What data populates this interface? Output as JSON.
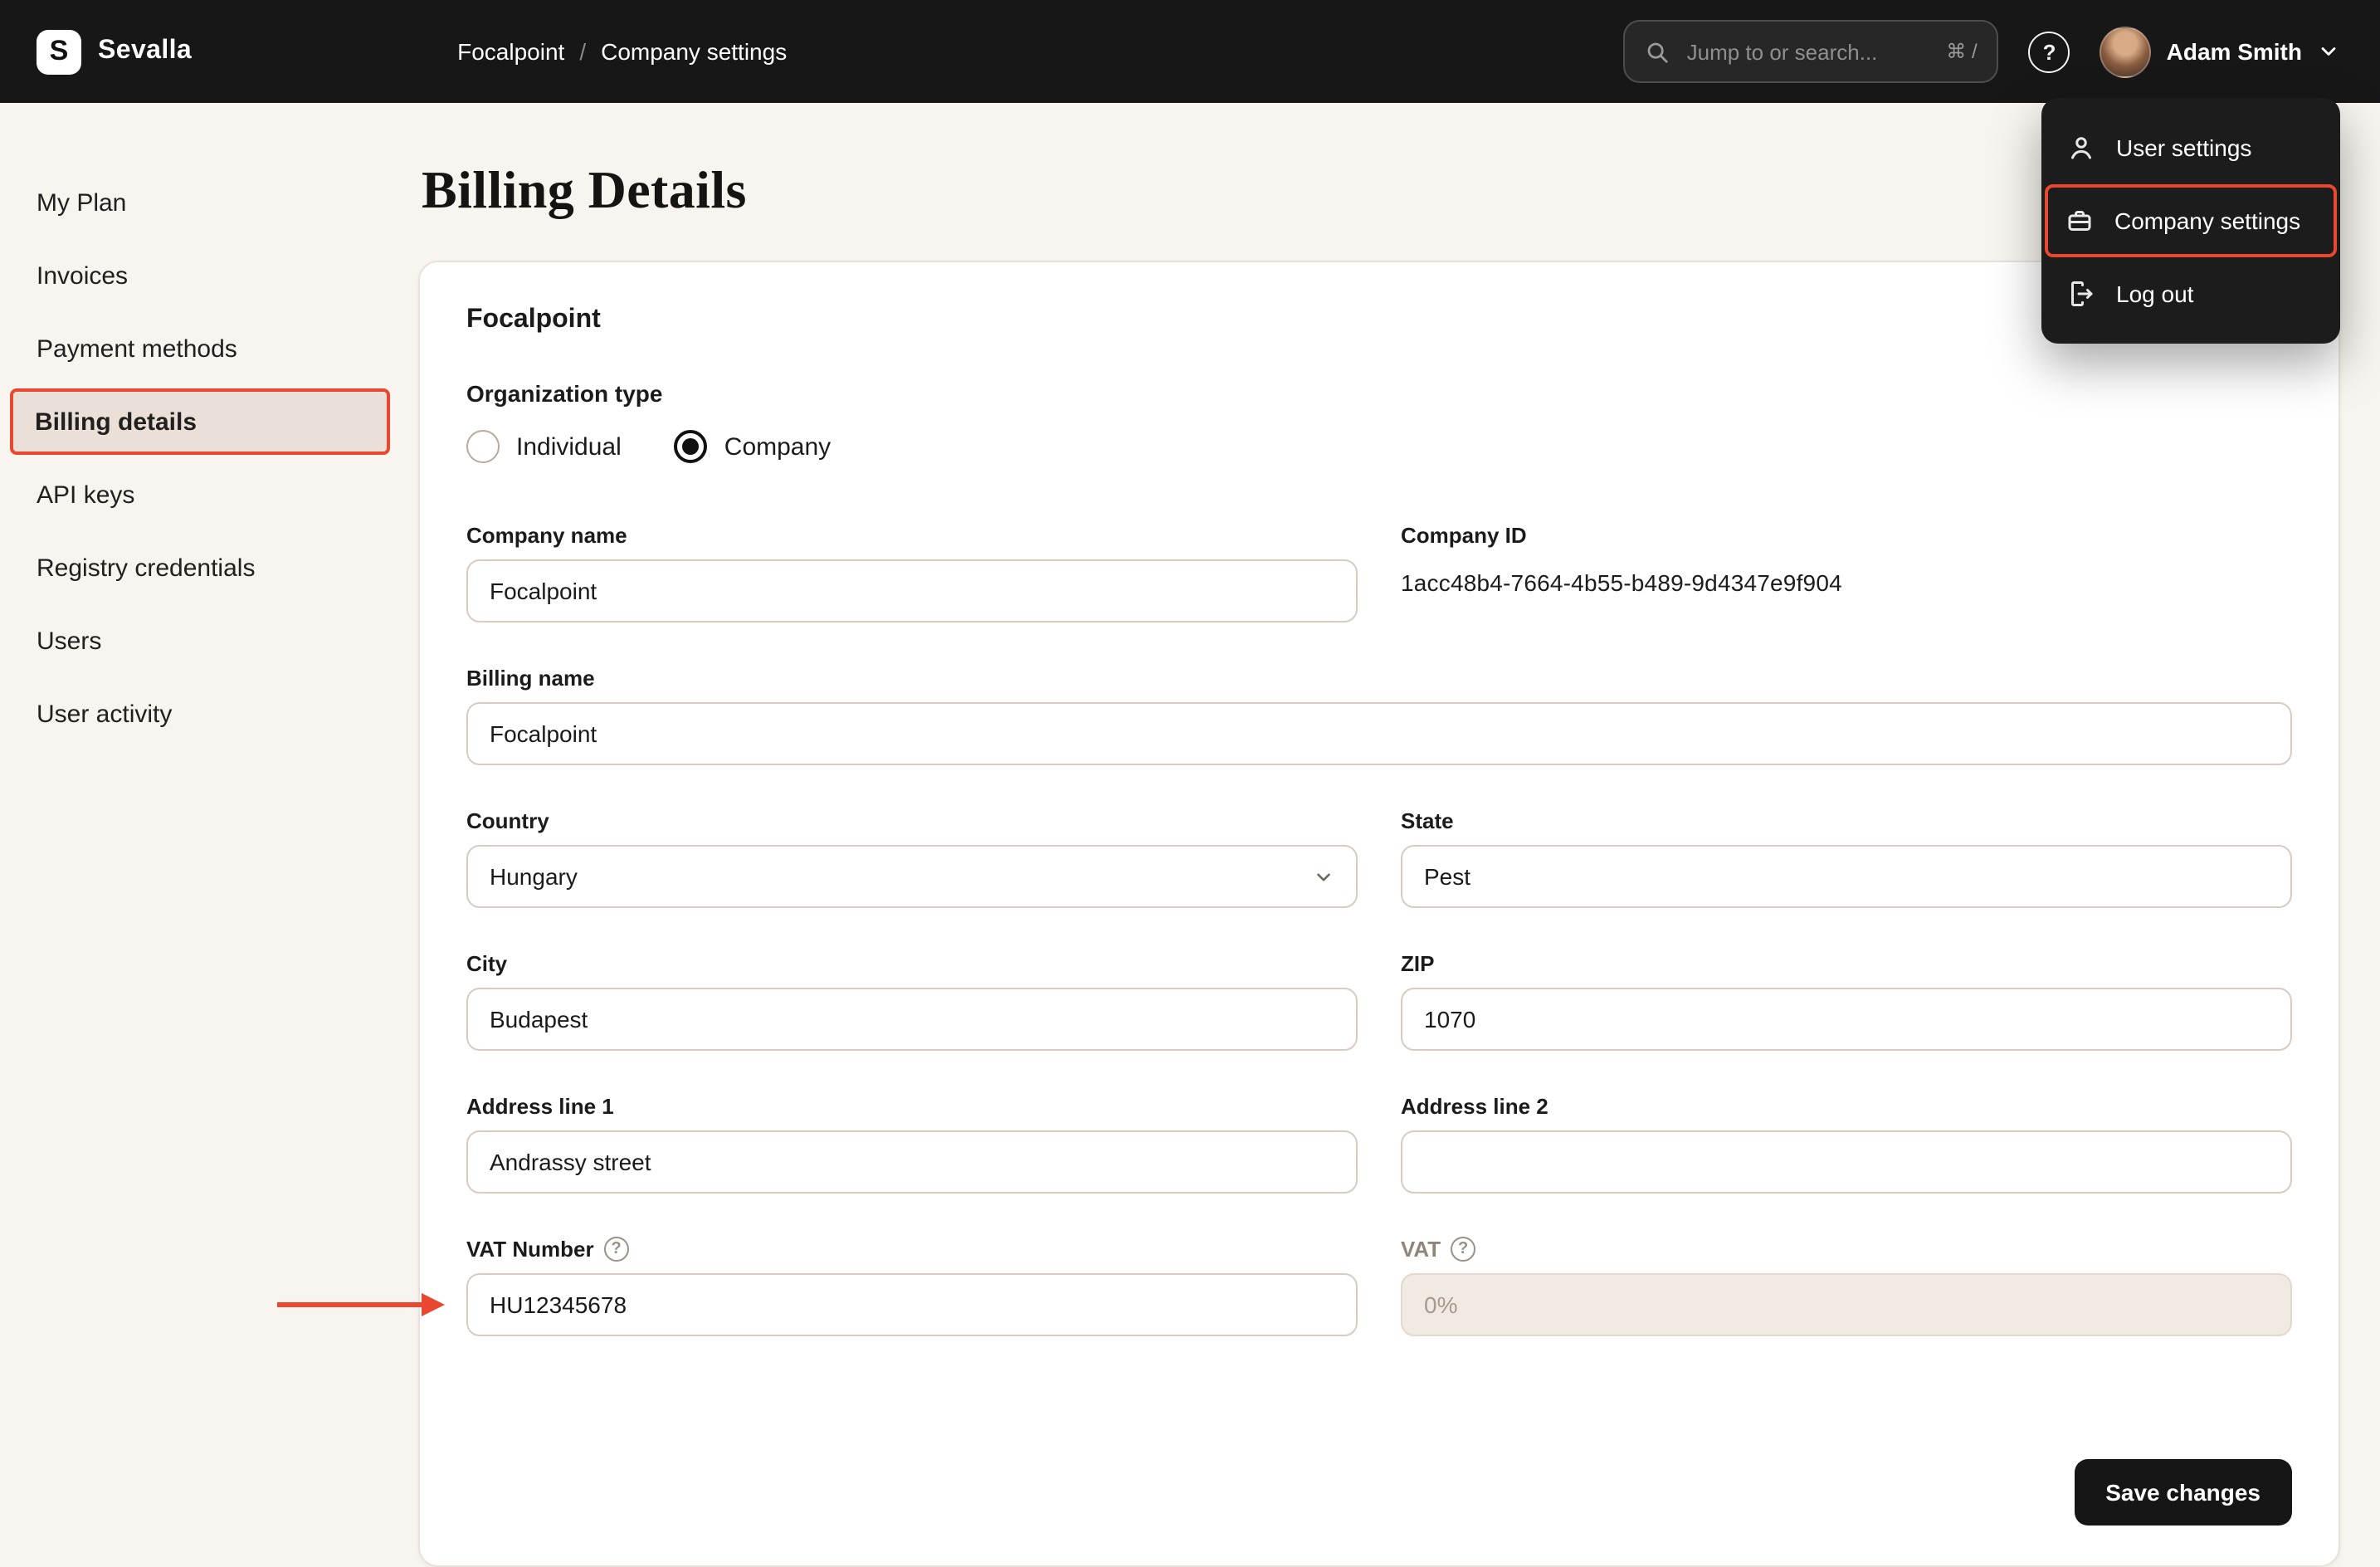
{
  "navbar": {
    "logo_glyph": "S",
    "brand": "Sevalla",
    "breadcrumb": {
      "project": "Focalpoint",
      "separator": "/",
      "page": "Company settings"
    },
    "search": {
      "placeholder": "Jump to or search...",
      "shortcut": "⌘ /"
    },
    "user": {
      "name": "Adam Smith"
    }
  },
  "user_menu": {
    "items": [
      {
        "label": "User settings",
        "icon": "user-icon",
        "highlighted": false
      },
      {
        "label": "Company settings",
        "icon": "briefcase-icon",
        "highlighted": true
      },
      {
        "label": "Log out",
        "icon": "logout-icon",
        "highlighted": false
      }
    ]
  },
  "sidebar": {
    "items": [
      {
        "label": "My Plan",
        "active": false
      },
      {
        "label": "Invoices",
        "active": false
      },
      {
        "label": "Payment methods",
        "active": false
      },
      {
        "label": "Billing details",
        "active": true
      },
      {
        "label": "API keys",
        "active": false
      },
      {
        "label": "Registry credentials",
        "active": false
      },
      {
        "label": "Users",
        "active": false
      },
      {
        "label": "User activity",
        "active": false
      }
    ]
  },
  "page": {
    "title": "Billing Details",
    "card": {
      "company_heading": "Focalpoint",
      "organization_type": {
        "label": "Organization type",
        "options": [
          {
            "label": "Individual",
            "selected": false
          },
          {
            "label": "Company",
            "selected": true
          }
        ]
      },
      "fields": {
        "company_name": {
          "label": "Company name",
          "value": "Focalpoint"
        },
        "company_id": {
          "label": "Company ID",
          "value": "1acc48b4-7664-4b55-b489-9d4347e9f904"
        },
        "billing_name": {
          "label": "Billing name",
          "value": "Focalpoint"
        },
        "country": {
          "label": "Country",
          "value": "Hungary"
        },
        "state": {
          "label": "State",
          "value": "Pest"
        },
        "city": {
          "label": "City",
          "value": "Budapest"
        },
        "zip": {
          "label": "ZIP",
          "value": "1070"
        },
        "address_line_1": {
          "label": "Address line 1",
          "value": "Andrassy street"
        },
        "address_line_2": {
          "label": "Address line 2",
          "value": ""
        },
        "vat_number": {
          "label": "VAT Number",
          "value": "HU12345678",
          "has_info": true
        },
        "vat": {
          "label": "VAT",
          "value": "0%",
          "disabled": true,
          "has_info": true
        }
      },
      "save_button": "Save changes"
    }
  },
  "colors": {
    "navbar_bg": "#171717",
    "page_bg": "#f8f4ef",
    "card_bg": "#ffffff",
    "annotation_red": "#e9472f",
    "active_item_bg": "#ebe0d7",
    "button_bg": "#161616",
    "input_border": "#d9cbbf"
  }
}
